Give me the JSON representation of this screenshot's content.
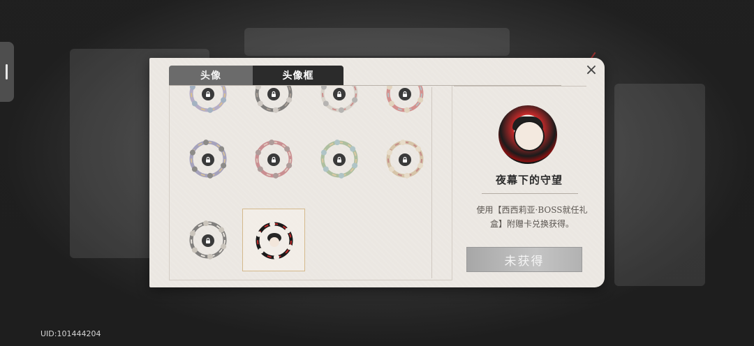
{
  "tabs": [
    {
      "label": "头像",
      "active": false
    },
    {
      "label": "头像框",
      "active": true
    }
  ],
  "close_glyph": "×",
  "frames": [
    {
      "id": 1,
      "locked": true,
      "colors": [
        "#8a7fb0",
        "#c9a24a",
        "#6a88a8"
      ]
    },
    {
      "id": 2,
      "locked": true,
      "colors": [
        "#2a2a2a",
        "#7a6b5e",
        "#b9b2aa"
      ]
    },
    {
      "id": 3,
      "locked": true,
      "colors": [
        "#c7c0b6",
        "#b34848",
        "#8b8b8b"
      ]
    },
    {
      "id": 4,
      "locked": true,
      "colors": [
        "#c04a4a",
        "#8aa0a8",
        "#d9c4a0"
      ]
    },
    {
      "id": 5,
      "locked": true,
      "colors": [
        "#6d6a9e",
        "#c0a060",
        "#404040"
      ]
    },
    {
      "id": 6,
      "locked": true,
      "colors": [
        "#b0474f",
        "#d6b0a0",
        "#7e5e5e"
      ]
    },
    {
      "id": 7,
      "locked": true,
      "colors": [
        "#7da06a",
        "#d2b070",
        "#7fa8b0"
      ]
    },
    {
      "id": 8,
      "locked": true,
      "colors": [
        "#c5a87a",
        "#a84040",
        "#e3d3b3"
      ]
    },
    {
      "id": 9,
      "locked": true,
      "colors": [
        "#2b2b2b",
        "#e8e2da",
        "#b0a89c"
      ]
    },
    {
      "id": 10,
      "locked": false,
      "selected": true,
      "colors": [
        "#1a1a1a",
        "#c22a2a",
        "#f0ece6"
      ]
    }
  ],
  "detail": {
    "name": "夜幕下的守望",
    "description": "使用【西西莉亚·BOSS就任礼盒】附赠卡兑换获得。",
    "status_label": "未获得"
  },
  "uid_text": "UID:101444204",
  "icons": {
    "close": "close-icon",
    "lock": "lock-icon"
  }
}
